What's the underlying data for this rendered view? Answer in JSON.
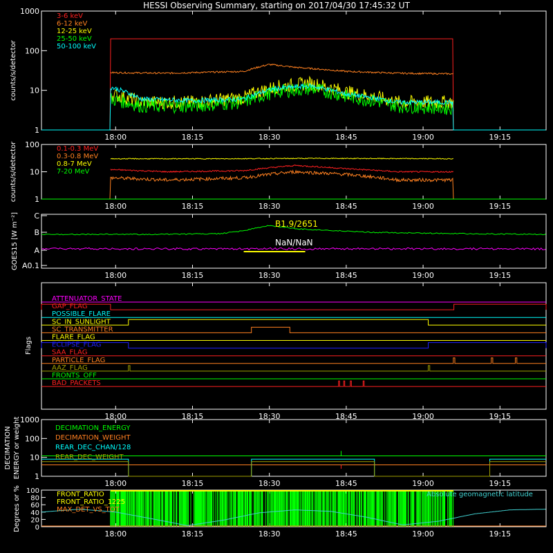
{
  "title": "HESSI Observing Summary, starting on 2017/04/30 17:45:32 UT",
  "colors": {
    "background": "#000000",
    "axes": "#ffffff",
    "red": "#ff2020",
    "orange": "#ff8020",
    "yellow": "#ffff00",
    "green": "#00ff00",
    "cyan": "#00ffff",
    "magenta": "#ff00ff",
    "blue": "#2020ff",
    "olive": "#a0a000",
    "teal": "#40d0d0"
  },
  "x_axis": {
    "ticks": [
      "18:00",
      "18:15",
      "18:30",
      "18:45",
      "19:00",
      "19:15"
    ],
    "tick_minutes": [
      0,
      15,
      30,
      45,
      60,
      75
    ],
    "range_minutes": [
      -14.47,
      84.0
    ]
  },
  "chart_data": [
    {
      "panel": "counts_low",
      "type": "line",
      "log": true,
      "ylabel": "counts/s/detector",
      "yticks": [
        "1",
        "10",
        "100",
        "1000"
      ],
      "yrange": [
        1,
        1000
      ],
      "series": [
        {
          "name": "3-6 keV",
          "color": "#ff2020",
          "x": [
            -14.47,
            -1,
            -0.99,
            65.9,
            65.91,
            84
          ],
          "y": [
            1,
            1,
            200,
            200,
            1,
            1
          ]
        },
        {
          "name": "6-12 keV",
          "color": "#ff8020",
          "x": [
            -1,
            10,
            25,
            30,
            35,
            45,
            55,
            65.9
          ],
          "y": [
            28,
            27,
            30,
            45,
            38,
            30,
            27,
            26
          ]
        },
        {
          "name": "12-25 keV",
          "color": "#ffff00",
          "x": [
            -1,
            5,
            15,
            25,
            31,
            38,
            45,
            55,
            65.9
          ],
          "y": [
            8,
            5,
            5,
            6.5,
            12,
            15,
            9,
            5,
            5
          ]
        },
        {
          "name": "25-50 keV",
          "color": "#00ff00",
          "x": [
            -1,
            5,
            15,
            25,
            31,
            38,
            45,
            55,
            65.9
          ],
          "y": [
            6,
            4,
            4,
            5,
            9,
            11,
            7,
            4,
            3.5
          ]
        },
        {
          "name": "50-100 keV",
          "color": "#00ffff",
          "x": [
            -14.47,
            -1,
            -0.99,
            5,
            15,
            25,
            31,
            38,
            45,
            55,
            65.9,
            65.91,
            84
          ],
          "y": [
            1,
            1,
            12,
            6,
            5.5,
            6,
            11,
            13,
            8,
            5,
            5,
            1,
            1
          ]
        }
      ]
    },
    {
      "panel": "counts_high",
      "type": "line",
      "log": true,
      "ylabel": "counts/s/detector",
      "yticks": [
        "1",
        "10",
        "100"
      ],
      "yrange": [
        1,
        100
      ],
      "series": [
        {
          "name": "0.1-0.3 MeV",
          "color": "#ff2020",
          "x": [
            -1,
            10,
            25,
            35,
            45,
            55,
            65.9
          ],
          "y": [
            12,
            10,
            11,
            17,
            13,
            10,
            10
          ]
        },
        {
          "name": "0.3-0.8 MeV",
          "color": "#ff8020",
          "x": [
            -14.47,
            -1,
            -0.99,
            10,
            25,
            35,
            45,
            55,
            65.9,
            65.91,
            84
          ],
          "y": [
            1,
            1,
            6,
            5,
            6,
            10,
            8,
            5,
            5,
            1,
            1
          ]
        },
        {
          "name": "0.8-7 MeV",
          "color": "#ffff00",
          "x": [
            -1,
            20,
            40,
            65.9
          ],
          "y": [
            30,
            30,
            31,
            30
          ]
        },
        {
          "name": "7-20 MeV",
          "color": "#00ff00",
          "x": [
            -14.47,
            84
          ],
          "y": [
            1,
            1
          ]
        }
      ]
    },
    {
      "panel": "goes",
      "type": "line",
      "ylabel": "GOES15 [W m⁻²]",
      "ytick_labels": [
        "A0.1",
        "A",
        "B",
        "C"
      ],
      "series": [
        {
          "color": "#00ff00",
          "x": [
            -14.47,
            10,
            20,
            24,
            30,
            36,
            50,
            70,
            84
          ],
          "y": [
            0.0,
            0.0,
            0.05,
            0.3,
            0.9,
            0.55,
            0.2,
            0.05,
            0.0
          ]
        },
        {
          "color": "#ff00ff",
          "x": [
            -14.47,
            84
          ],
          "y": [
            0,
            0
          ]
        },
        {
          "color": "#ffff00",
          "x": [
            25,
            37
          ],
          "y": [
            0,
            0
          ]
        }
      ],
      "annotations": [
        "B1.9/2651",
        "NaN/NaN"
      ]
    },
    {
      "panel": "flags",
      "ylabel": "Flags",
      "flags": [
        {
          "name": "ATTENUATOR_STATE",
          "color": "#ff00ff",
          "high_ranges": []
        },
        {
          "name": "GAP_FLAG",
          "color": "#ff2020",
          "high_ranges": [
            [
              -14.47,
              -1
            ],
            [
              66,
              84
            ]
          ]
        },
        {
          "name": "POSSIBLE_FLARE",
          "color": "#00ffff",
          "high_ranges": []
        },
        {
          "name": "SC_IN_SUNLIGHT",
          "color": "#ffff00",
          "high_ranges": [
            [
              2.5,
              61
            ]
          ]
        },
        {
          "name": "SC_TRANSMITTER",
          "color": "#ff8020",
          "high_ranges": [
            [
              26.5,
              34
            ]
          ]
        },
        {
          "name": "FLARE_FLAG",
          "color": "#ffff00",
          "high_ranges": []
        },
        {
          "name": "ECLIPSE_FLAG",
          "color": "#2020ff",
          "high_ranges": [
            [
              -14.47,
              2.5
            ],
            [
              61,
              84
            ]
          ]
        },
        {
          "name": "SAA_FLAG",
          "color": "#ff2020",
          "high_ranges": []
        },
        {
          "name": "PARTICLE_FLAG",
          "color": "#ff8020",
          "high_ranges": [
            [
              65.9,
              66.2
            ],
            [
              73.3,
              73.6
            ],
            [
              78,
              78.3
            ]
          ]
        },
        {
          "name": "AAZ_FLAG",
          "color": "#a0a000",
          "high_ranges": [
            [
              2.5,
              2.8
            ],
            [
              61,
              61.3
            ]
          ]
        },
        {
          "name": "FRONTS_OFF",
          "color": "#00ff00",
          "high_ranges": []
        },
        {
          "name": "BAD_PACKETS",
          "color": "#ff2020",
          "high_ranges": [
            [
              43.5,
              43.7
            ],
            [
              44.5,
              44.7
            ],
            [
              45.8,
              46
            ],
            [
              48.3,
              48.5
            ]
          ]
        }
      ]
    },
    {
      "panel": "decimation",
      "type": "line",
      "log": true,
      "ylabel": "DECIMATION ENERGY or weight",
      "yticks": [
        "1",
        "10",
        "100",
        "1000"
      ],
      "yrange": [
        1,
        1000
      ],
      "series": [
        {
          "name": "DECIMATION_ENERGY",
          "color": "#00ff00",
          "x": [
            -14.47,
            84
          ],
          "y": [
            12,
            12
          ]
        },
        {
          "name": "DECIMATION_WEIGHT",
          "color": "#ff8020",
          "x": [
            -14.47,
            84
          ],
          "y": [
            4,
            4
          ]
        },
        {
          "name": "REAR_DEC_CHAN/128",
          "color": "#00ffff",
          "x": [
            -14.47,
            2.5,
            2.51,
            26.5,
            26.51,
            50.5,
            50.51,
            73,
            73.01,
            84
          ],
          "y": [
            8,
            8,
            1,
            1,
            8,
            8,
            1,
            1,
            8,
            8
          ]
        },
        {
          "name": "REAR_DEC_WEIGHT",
          "color": "#a0a000",
          "x": [
            -14.47,
            2.5,
            2.51,
            26.5,
            26.51,
            50.5,
            50.51,
            73,
            73.01,
            84
          ],
          "y": [
            6,
            6,
            1,
            1,
            6,
            6,
            1,
            1,
            6,
            6
          ]
        }
      ]
    },
    {
      "panel": "ratios",
      "type": "line",
      "ylabel": "Degrees or %",
      "yticks": [
        "0",
        "20",
        "40",
        "60",
        "80",
        "100"
      ],
      "yrange": [
        0,
        100
      ],
      "series": [
        {
          "name": "FRONT_RATIO",
          "color": "#00ff00",
          "x": [
            -1,
            65.9
          ],
          "y": [
            100,
            100
          ]
        },
        {
          "name": "FRONT_RATIO_1225",
          "color": "#ffff00",
          "x": [
            -1,
            65.9
          ],
          "y": [
            100,
            100
          ]
        },
        {
          "name": "MAX_DET_VS_TOT",
          "color": "#ff8020",
          "x": [
            -14.47,
            84
          ],
          "y": [
            0,
            0
          ]
        },
        {
          "name": "Absolute geomagnetic latitude",
          "color": "#40d0d0",
          "x": [
            -14.47,
            -7,
            0,
            7,
            14,
            21,
            28,
            35,
            42,
            49,
            56,
            63,
            70,
            77,
            84
          ],
          "y": [
            40,
            48,
            40,
            22,
            3,
            18,
            38,
            46,
            42,
            26,
            5,
            15,
            35,
            46,
            48
          ]
        }
      ]
    }
  ]
}
